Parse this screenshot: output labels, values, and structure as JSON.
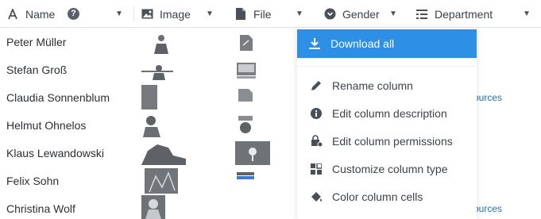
{
  "columns": [
    {
      "label": "Name",
      "icon": "text-icon",
      "help_icon": "question-circle-icon"
    },
    {
      "label": "Image",
      "icon": "image-icon"
    },
    {
      "label": "File",
      "icon": "file-icon"
    },
    {
      "label": "Gender",
      "icon": "single-select-icon"
    },
    {
      "label": "Department",
      "icon": "list-icon"
    }
  ],
  "rows": [
    {
      "name": "Peter Müller"
    },
    {
      "name": "Stefan Groß"
    },
    {
      "name": "Claudia Sonnenblum"
    },
    {
      "name": "Helmut Ohnelos"
    },
    {
      "name": "Klaus Lewandowski"
    },
    {
      "name": "Felix Sohn"
    },
    {
      "name": "Christina Wolf"
    }
  ],
  "partial_text": [
    "ources",
    "ources"
  ],
  "column_menu": {
    "download_label": "Download all",
    "items": [
      {
        "label": "Rename column",
        "icon": "pencil-icon"
      },
      {
        "label": "Edit column description",
        "icon": "info-icon"
      },
      {
        "label": "Edit column permissions",
        "icon": "lock-gear-icon"
      },
      {
        "label": "Customize column type",
        "icon": "column-type-icon"
      },
      {
        "label": "Color column cells",
        "icon": "paint-bucket-icon"
      }
    ]
  },
  "colors": {
    "accent": "#2d8fe6",
    "text": "#2b2f33",
    "link": "#2a6fb0"
  }
}
